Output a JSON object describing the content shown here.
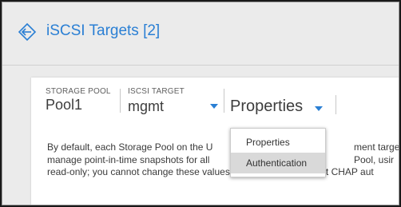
{
  "header": {
    "title": "iSCSI Targets [2]",
    "icon": "diamond-arrow-icon",
    "accent": "#2a7fd4"
  },
  "selectors": {
    "storage_pool": {
      "label": "STORAGE POOL",
      "value": "Pool1"
    },
    "iscsi_target": {
      "label": "ISCSI TARGET",
      "value": "mgmt"
    },
    "view": {
      "value": "Properties"
    }
  },
  "description": [
    "By default, each Storage Pool on the U",
    "manage point-in-time snapshots for all",
    "read-only; you cannot change these values. You can, however, set CHAP aut"
  ],
  "description_right": [
    "ment targe",
    "Pool, usir"
  ],
  "dropdown": {
    "items": [
      {
        "label": "Properties"
      },
      {
        "label": "Authentication"
      }
    ],
    "hovered_index": 1
  }
}
